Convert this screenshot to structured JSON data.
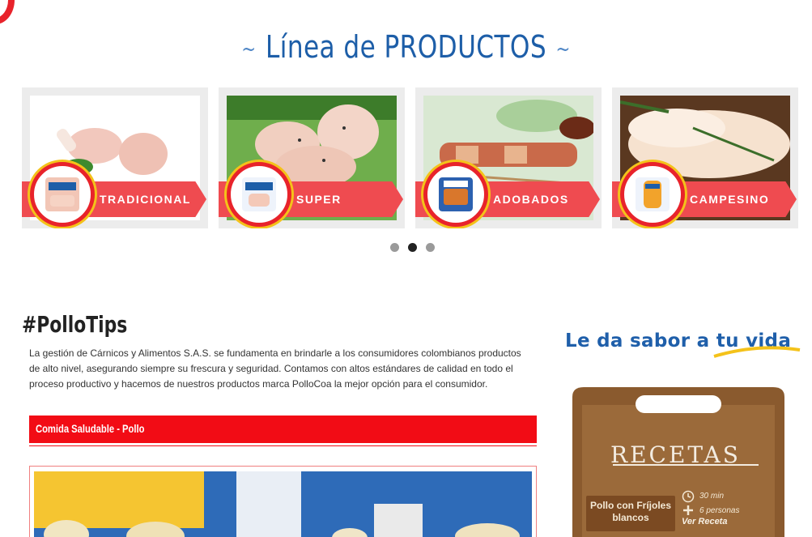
{
  "header": {
    "title": "Línea de PRODUCTOS",
    "tilde_left": "~",
    "tilde_right": "~"
  },
  "products": [
    {
      "label": "TRADICIONAL",
      "accent": "#ef4b50"
    },
    {
      "label": "SUPER",
      "accent": "#ef4b50"
    },
    {
      "label": "ADOBADOS",
      "accent": "#ef4b50"
    },
    {
      "label": "CAMPESINO",
      "accent": "#ef4b50"
    }
  ],
  "carousel": {
    "pages": 3,
    "active_page": 2
  },
  "tips": {
    "title": "#PolloTips",
    "text": "La gestión de Cárnicos y Alimentos S.A.S. se fundamenta en brindarle a los consumidores colombianos productos de alto nivel, asegurando siempre su frescura y seguridad. Contamos con altos estándares de calidad en todo el proceso productivo y hacemos de nuestros productos marca PolloCoa la mejor opción para el consumidor.",
    "article_title": "Comida Saludable - Pollo"
  },
  "sidebar": {
    "slogan": "Le da sabor a tu vida",
    "recetas_title": "RECETAS",
    "dish_name": "Pollo con Fríjoles blancos",
    "time": "30 min",
    "servings": "6 personas",
    "link": "Ver Receta"
  },
  "colors": {
    "brand_blue": "#1d5ea8",
    "brand_red": "#f20c15",
    "ribbon_red": "#ef4b50",
    "badge_yellow": "#f4c21a",
    "wood": "#8a5a2e"
  }
}
